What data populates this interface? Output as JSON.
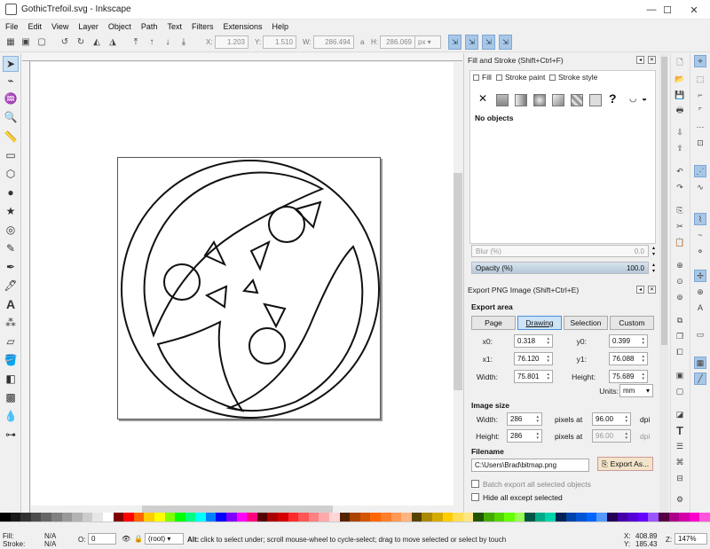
{
  "window": {
    "title": "GothicTrefoil.svg - Inkscape",
    "minimize": "—",
    "maximize": "☐",
    "close": "✕"
  },
  "menu": [
    "File",
    "Edit",
    "View",
    "Layer",
    "Object",
    "Path",
    "Text",
    "Filters",
    "Extensions",
    "Help"
  ],
  "controls": {
    "x_label": "X:",
    "x_value": "1.203",
    "y_label": "Y:",
    "y_value": "1.510",
    "w_label": "W:",
    "w_value": "286.494",
    "lock_icon": "a",
    "h_label": "H:",
    "h_value": "286.069",
    "unit": "px"
  },
  "fill_stroke": {
    "title": "Fill and Stroke (Shift+Ctrl+F)",
    "tabs": [
      "Fill",
      "Stroke paint",
      "Stroke style"
    ],
    "no_objects": "No objects",
    "blur_label": "Blur (%)",
    "blur_value": "0.0",
    "opacity_label": "Opacity (%)",
    "opacity_value": "100.0",
    "unknown_icon": "?"
  },
  "export": {
    "title": "Export PNG Image (Shift+Ctrl+E)",
    "area_heading": "Export area",
    "area_buttons": [
      "Page",
      "Drawing",
      "Selection",
      "Custom"
    ],
    "active_area": "Drawing",
    "x0_label": "x0:",
    "x0": "0.318",
    "y0_label": "y0:",
    "y0": "0.399",
    "x1_label": "x1:",
    "x1": "76.120",
    "y1_label": "y1:",
    "y1": "76.088",
    "width_label": "Width:",
    "width": "75.801",
    "height_label": "Height:",
    "height": "75.689",
    "units_label": "Units:",
    "units": "mm",
    "image_size_heading": "Image size",
    "img_width_label": "Width:",
    "img_width": "286",
    "img_height_label": "Height:",
    "img_height": "286",
    "pixels_at": "pixels at",
    "dpi1": "96.00",
    "dpi2": "96.00",
    "dpi_label": "dpi",
    "filename_heading": "Filename",
    "filename": "C:\\Users\\Brad\\bitmap.png",
    "export_as": "Export As...",
    "batch": "Batch export all selected objects",
    "hide": "Hide all except selected"
  },
  "status": {
    "fill_label": "Fill:",
    "fill_value": "N/A",
    "stroke_label": "Stroke:",
    "stroke_value": "N/A",
    "o_label": "O:",
    "o_value": "0",
    "layer": "(root)",
    "message_key": "Alt:",
    "message": "click to select under; scroll mouse-wheel to cycle-select; drag to move selected or select by touch",
    "x_label": "X:",
    "x_value": "408.89",
    "y_label": "Y:",
    "y_value": "185.43",
    "z_label": "Z:",
    "zoom": "147%"
  },
  "colors": {
    "accent": "#a7c7e7",
    "active_tab": "#cde4f7"
  }
}
